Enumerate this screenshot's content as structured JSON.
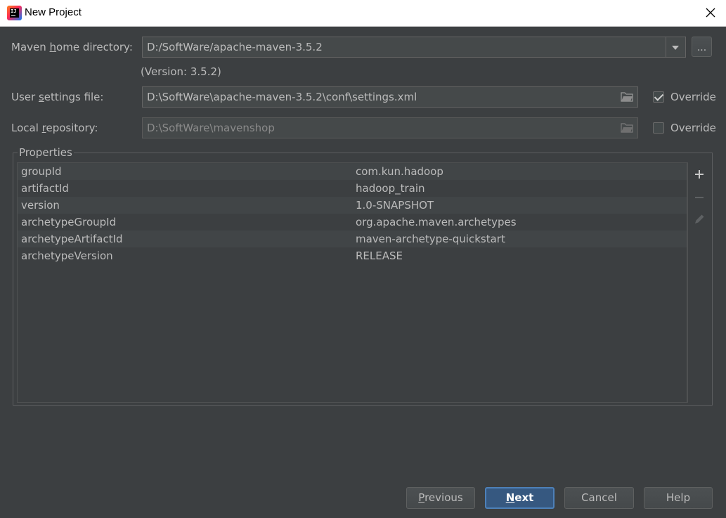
{
  "window": {
    "title": "New Project"
  },
  "maven_home": {
    "label_pre": "Maven ",
    "label_mnemonic": "h",
    "label_post": "ome directory:",
    "value": "D:/SoftWare/apache-maven-3.5.2",
    "version_note": "(Version: 3.5.2)",
    "browse_label": "..."
  },
  "user_settings": {
    "label_pre": "User ",
    "label_mnemonic": "s",
    "label_post": "ettings file:",
    "value": "D:\\SoftWare\\apache-maven-3.5.2\\conf\\settings.xml",
    "override_label": "Override",
    "override_checked": true
  },
  "local_repo": {
    "label_pre": "Local ",
    "label_mnemonic": "r",
    "label_post": "epository:",
    "value": "D:\\SoftWare\\mavenshop",
    "override_label": "Override",
    "override_checked": false
  },
  "properties": {
    "title": "Properties",
    "rows": [
      {
        "key": "groupId",
        "value": "com.kun.hadoop"
      },
      {
        "key": "artifactId",
        "value": "hadoop_train"
      },
      {
        "key": "version",
        "value": "1.0-SNAPSHOT"
      },
      {
        "key": "archetypeGroupId",
        "value": "org.apache.maven.archetypes"
      },
      {
        "key": "archetypeArtifactId",
        "value": "maven-archetype-quickstart"
      },
      {
        "key": "archetypeVersion",
        "value": "RELEASE"
      }
    ],
    "tools": [
      "plus-icon",
      "minus-icon",
      "pencil-icon"
    ]
  },
  "buttons": {
    "previous": {
      "mnemonic": "P",
      "rest": "revious"
    },
    "next": {
      "mnemonic": "N",
      "rest": "ext"
    },
    "cancel": "Cancel",
    "help": "Help"
  },
  "colors": {
    "background": "#3c3f41",
    "field": "#45494a",
    "primary_button": "#365880",
    "text": "#bbbbbb"
  }
}
